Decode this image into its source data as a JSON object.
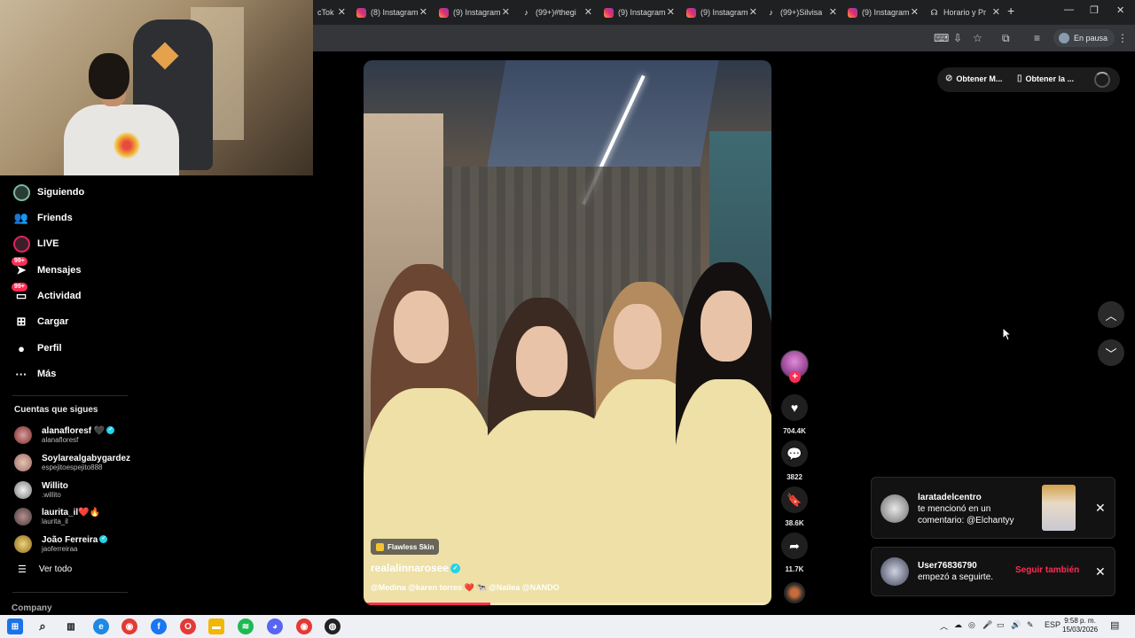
{
  "browser": {
    "tabs": [
      {
        "label": "cTok",
        "icon": "tiktok-icon"
      },
      {
        "label": "(8) Instagram",
        "icon": "instagram-icon"
      },
      {
        "label": "(9) Instagram",
        "icon": "instagram-icon"
      },
      {
        "label": "(99+)#thegi",
        "icon": "tiktok-icon"
      },
      {
        "label": "(9) Instagram",
        "icon": "instagram-icon"
      },
      {
        "label": "(9) Instagram",
        "icon": "instagram-icon"
      },
      {
        "label": "(99+)Silvisa",
        "icon": "tiktok-icon"
      },
      {
        "label": "(9) Instagram",
        "icon": "instagram-icon"
      },
      {
        "label": "Horario y Pr",
        "icon": "headset-icon"
      }
    ],
    "profile_label": "En pausa"
  },
  "sidebar": {
    "nav": [
      {
        "label": "Siguiendo",
        "icon": "following-avatar-icon"
      },
      {
        "label": "Friends",
        "icon": "friends-icon"
      },
      {
        "label": "LIVE",
        "icon": "live-icon"
      },
      {
        "label": "Mensajes",
        "icon": "messages-icon",
        "badge": "99+"
      },
      {
        "label": "Actividad",
        "icon": "activity-icon",
        "badge": "99+"
      },
      {
        "label": "Cargar",
        "icon": "upload-icon"
      },
      {
        "label": "Perfil",
        "icon": "profile-icon"
      },
      {
        "label": "Más",
        "icon": "more-icon"
      }
    ],
    "following_title": "Cuentas que sigues",
    "accounts": [
      {
        "name": "alanafloresf",
        "suffix": "🖤",
        "handle": "alanafloresf",
        "verified": true
      },
      {
        "name": "Soylarealgabygardez",
        "suffix": "",
        "handle": "espejitoespejito888",
        "verified": false
      },
      {
        "name": "Willito",
        "suffix": "",
        "handle": ".willito",
        "verified": false
      },
      {
        "name": "laurita_il",
        "suffix": "❤️🔥",
        "handle": "laurita_il",
        "verified": false
      },
      {
        "name": "João Ferreira",
        "suffix": "",
        "handle": "jaoferreiraa",
        "verified": true
      }
    ],
    "see_all": "Ver todo",
    "company": "Company"
  },
  "video": {
    "effect_tag": "Flawless Skin",
    "author": "realalinnarosee",
    "caption": "@Medina @karen torres ❤️ 🐄 @Nailea @NANDO",
    "progress": 0.31
  },
  "actions": {
    "likes": "704.4K",
    "comments": "3822",
    "saves": "38.6K",
    "shares": "11.7K"
  },
  "top_buttons": {
    "get_app_1": "Obtener M...",
    "get_app_2": "Obtener la ..."
  },
  "notifications": [
    {
      "title": "laratadelcentro",
      "line1": "te mencionó en un",
      "line2": "comentario: @Elchantyy"
    },
    {
      "title": "User76836790",
      "line1": "empezó a seguirte.",
      "action": "Seguir también"
    }
  ],
  "taskbar": {
    "lang": "ESP",
    "time": "9:58 p. m.",
    "date": "15/03/2026"
  },
  "colors": {
    "accent": "#fe2c55",
    "verified": "#20d5ec",
    "background": "#000000"
  }
}
